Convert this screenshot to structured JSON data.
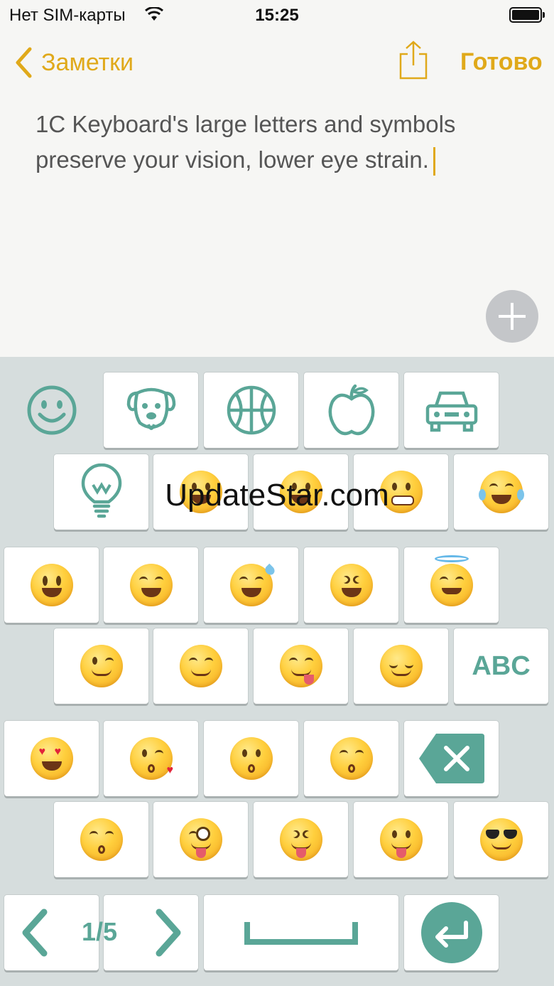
{
  "status_bar": {
    "carrier": "Нет SIM-карты",
    "time": "15:25"
  },
  "nav": {
    "back_label": "Заметки",
    "done_label": "Готово"
  },
  "note": {
    "text": "1C Keyboard's large letters and symbols preserve your vision, lower eye strain."
  },
  "watermark": "UpdateStar.com",
  "keyboard": {
    "category_icons": [
      "smiley-icon",
      "dog-icon",
      "basketball-icon",
      "apple-icon",
      "car-icon",
      "lightbulb-icon"
    ],
    "abc_label": "ABC",
    "page_indicator": "1/5",
    "accent_color": "#5aa697"
  },
  "colors": {
    "accent": "#e0a91a",
    "keyboard_bg": "#d6dddd"
  }
}
